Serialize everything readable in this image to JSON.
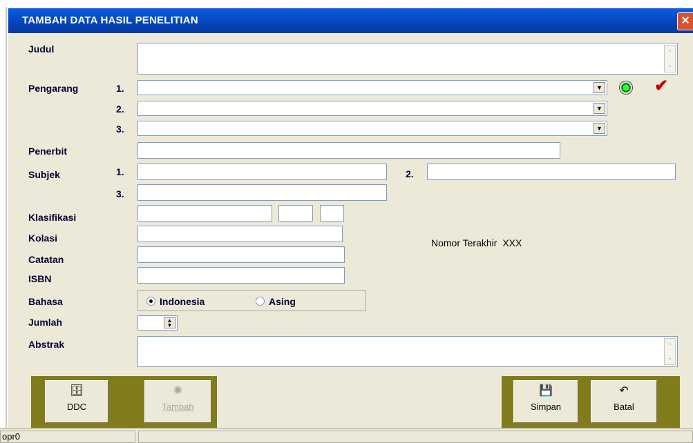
{
  "window": {
    "title": "TAMBAH DATA HASIL PENELITIAN",
    "close_glyph": "✕"
  },
  "labels": {
    "judul": "Judul",
    "pengarang": "Pengarang",
    "penerbit": "Penerbit",
    "subjek": "Subjek",
    "klasifikasi": "Klasifikasi",
    "kolasi": "Kolasi",
    "catatan": "Catatan",
    "isbn": "ISBN",
    "bahasa": "Bahasa",
    "jumlah": "Jumlah",
    "abstrak": "Abstrak"
  },
  "numbers": {
    "n1": "1.",
    "n2": "2.",
    "n3": "3."
  },
  "fields": {
    "judul": "",
    "pengarang_1": "",
    "pengarang_2": "",
    "pengarang_3": "",
    "penerbit": "",
    "subjek_1": "",
    "subjek_2": "",
    "subjek_3": "",
    "klasifikasi_1": "",
    "klasifikasi_2": "",
    "klasifikasi_3": "",
    "kolasi": "",
    "catatan": "",
    "isbn": "",
    "jumlah": "",
    "abstrak": ""
  },
  "bahasa": {
    "options": [
      "Indonesia",
      "Asing"
    ],
    "selected": "Indonesia"
  },
  "nomor_terakhir": {
    "label": "Nomor Terakhir",
    "value": "XXX"
  },
  "buttons": {
    "ddc": "DDC",
    "tambah": "Tambah",
    "simpan": "Simpan",
    "batal": "Batal"
  },
  "icons": {
    "green_indicator": "green-status-icon",
    "check": "checkmark-icon"
  },
  "colors": {
    "titlebar": "#0644b8",
    "button_group": "#807c1c",
    "check": "#cc0000",
    "label": "#000033"
  },
  "status_bar": {
    "user": "opr0",
    "message": ""
  }
}
